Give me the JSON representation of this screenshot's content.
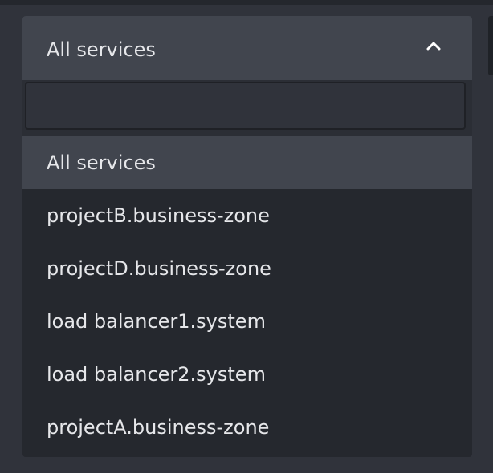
{
  "select": {
    "selected_label": "All services",
    "icon": "chevron-up-icon"
  },
  "search": {
    "value": "",
    "placeholder": ""
  },
  "options": [
    {
      "label": "All services",
      "selected": true
    },
    {
      "label": "projectB.business-zone",
      "selected": false
    },
    {
      "label": "projectD.business-zone",
      "selected": false
    },
    {
      "label": "load balancer1.system",
      "selected": false
    },
    {
      "label": "load balancer2.system",
      "selected": false
    },
    {
      "label": "projectA.business-zone",
      "selected": false
    }
  ],
  "colors": {
    "page_background": "#30333b",
    "header_background": "#41454e",
    "list_background": "#25282e",
    "text": "#e6e7ea"
  }
}
